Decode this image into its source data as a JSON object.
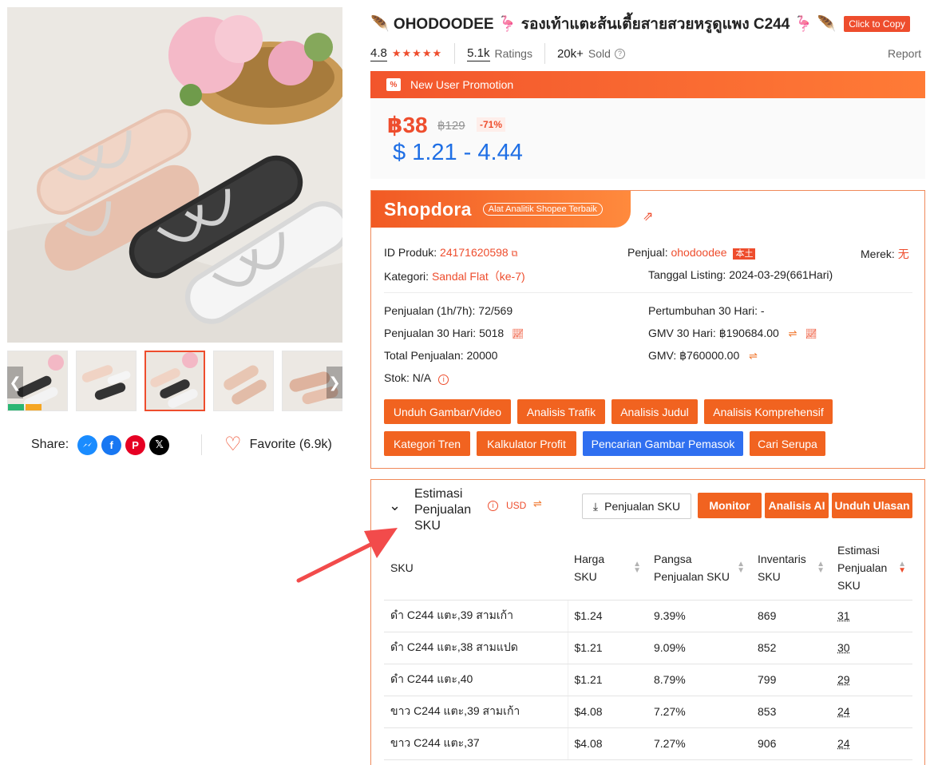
{
  "product": {
    "title": "🪶 OHODOODEE 🦩 รองเท้าแตะส้นเตี้ยสายสวยหรูดูแพง C244 🦩 🪶",
    "copy_label": "Click to Copy",
    "rating": "4.8",
    "stars": "★★★★★",
    "ratings_count": "5.1k",
    "ratings_label": "Ratings",
    "sold_count": "20k+",
    "sold_label": "Sold",
    "report_label": "Report"
  },
  "gallery": {
    "thumbnails": [
      "thumb-1",
      "thumb-2",
      "thumb-3",
      "thumb-4",
      "thumb-5"
    ],
    "active_index": 2
  },
  "share": {
    "label": "Share:",
    "icons": [
      "messenger-icon",
      "facebook-icon",
      "pinterest-icon",
      "x-icon"
    ],
    "favorite_label": "Favorite (6.9k)"
  },
  "promo": {
    "label": "New User Promotion",
    "price": "฿38",
    "original_price": "฿129",
    "discount": "-71%",
    "usd_range": "$ 1.21 - 4.44"
  },
  "shopdora": {
    "logo": "Shopdora",
    "tagline": "Alat Analitik Shopee Terbaik",
    "product_id_label": "ID Produk:",
    "product_id": "24171620598",
    "seller_label": "Penjual:",
    "seller": "ohodoodee",
    "local_badge": "本土",
    "brand_label": "Merek:",
    "brand": "无",
    "category_label": "Kategori:",
    "category": "Sandal Flat（ke-7)",
    "listing_label": "Tanggal Listing:",
    "listing": "2024-03-29(661Hari)",
    "sales_1h7h": "Penjualan (1h/7h): 72/569",
    "growth_30": "Pertumbuhan 30 Hari: -",
    "sales_30": "Penjualan 30 Hari: 5018",
    "gmv_30": "GMV 30 Hari: ฿190684.00",
    "total_sales": "Total Penjualan: 20000",
    "gmv": "GMV: ฿760000.00",
    "stock": "Stok: N/A",
    "buttons": [
      "Unduh Gambar/Video",
      "Analisis Trafik",
      "Analisis Judul",
      "Analisis Komprehensif",
      "Kategori Tren",
      "Kalkulator Profit",
      "Pencarian Gambar Pemasok",
      "Cari Serupa"
    ]
  },
  "sku": {
    "title": "Estimasi Penjualan SKU",
    "currency": "USD",
    "download_label": "Penjualan SKU",
    "monitor_label": "Monitor",
    "ai_label": "Analisis AI",
    "reviews_label": "Unduh Ulasan",
    "headers": [
      "SKU",
      "Harga SKU",
      "Pangsa Penjualan SKU",
      "Inventaris SKU",
      "Estimasi Penjualan SKU"
    ],
    "rows": [
      [
        "ดำ C244 แตะ,39 สามเก้า",
        "$1.24",
        "9.39%",
        "869",
        "31"
      ],
      [
        "ดำ C244 แตะ,38 สามแปด",
        "$1.21",
        "9.09%",
        "852",
        "30"
      ],
      [
        "ดำ C244 แตะ,40",
        "$1.21",
        "8.79%",
        "799",
        "29"
      ],
      [
        "ขาว C244 แตะ,39 สามเก้า",
        "$4.08",
        "7.27%",
        "853",
        "24"
      ],
      [
        "ขาว C244 แตะ,37",
        "$4.08",
        "7.27%",
        "906",
        "24"
      ]
    ]
  },
  "colors": {
    "accent": "#ee4d2d",
    "usd_blue": "#1f6fe5",
    "button_orange": "#f16320",
    "button_blue": "#2f6ff0",
    "arrow_red": "#f24b4b"
  }
}
